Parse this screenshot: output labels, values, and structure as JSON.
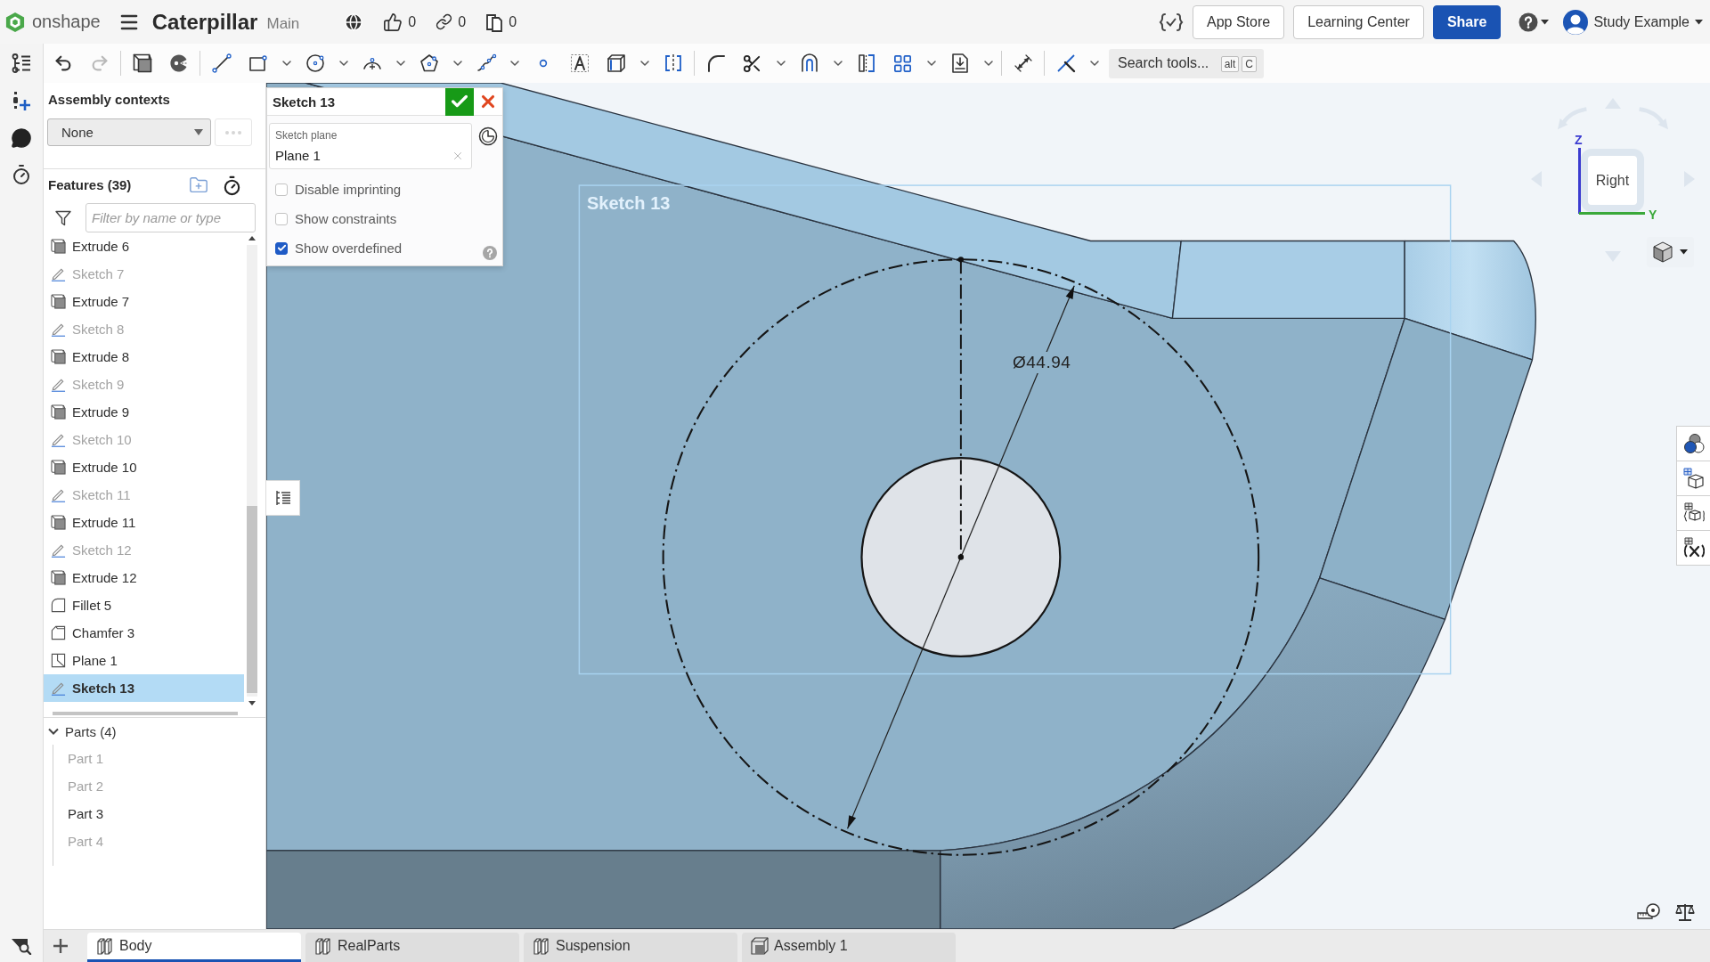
{
  "header": {
    "brand": "onshape",
    "document_title": "Caterpillar",
    "branch": "Main",
    "counters": [
      {
        "kind": "likes",
        "value": "0"
      },
      {
        "kind": "links",
        "value": "0"
      },
      {
        "kind": "copies",
        "value": "0"
      }
    ],
    "buttons": [
      {
        "label": "App Store",
        "kind": "secondary"
      },
      {
        "label": "Learning Center",
        "kind": "secondary"
      },
      {
        "label": "Share",
        "kind": "primary"
      }
    ],
    "user_name": "Study Example"
  },
  "side_rail": [
    {
      "kind": "feature_list"
    },
    {
      "kind": "insert"
    },
    {
      "kind": "comments"
    },
    {
      "kind": "history"
    }
  ],
  "toolbar": {
    "history": [
      {
        "kind": "undo",
        "disabled": false
      },
      {
        "kind": "redo",
        "disabled": true
      }
    ],
    "groups": [
      {
        "tools": [
          {
            "kind": "part_studio",
            "dropdown": false
          },
          {
            "kind": "sketch_tools",
            "dropdown": false
          }
        ]
      },
      {
        "tools": [
          {
            "kind": "line",
            "dropdown": false
          },
          {
            "kind": "rectangle",
            "dropdown": true
          },
          {
            "kind": "circle",
            "dropdown": true
          },
          {
            "kind": "arc",
            "dropdown": true
          },
          {
            "kind": "polygon",
            "dropdown": true
          },
          {
            "kind": "spline",
            "dropdown": true
          },
          {
            "kind": "point",
            "dropdown": false
          },
          {
            "kind": "text",
            "dropdown": false
          },
          {
            "kind": "use",
            "dropdown": true
          },
          {
            "kind": "mirror",
            "dropdown": false
          }
        ]
      },
      {
        "tools": [
          {
            "kind": "fillet",
            "dropdown": false
          },
          {
            "kind": "trim",
            "dropdown": true
          },
          {
            "kind": "offset",
            "dropdown": true
          },
          {
            "kind": "split",
            "dropdown": false
          },
          {
            "kind": "pattern",
            "dropdown": true
          },
          {
            "kind": "import",
            "dropdown": true
          }
        ]
      },
      {
        "tools": [
          {
            "kind": "dimension",
            "dropdown": false
          }
        ]
      },
      {
        "tools": [
          {
            "kind": "construction",
            "dropdown": true
          }
        ]
      }
    ],
    "search": {
      "placeholder": "Search tools...",
      "shortcut": [
        "alt",
        "C"
      ]
    }
  },
  "assembly_contexts": {
    "title": "Assembly contexts",
    "value": "None"
  },
  "features": {
    "title": "Features (39)",
    "filter_placeholder": "Filter by name or type",
    "items": [
      {
        "name": "Extrude 6",
        "kind": "extrude",
        "hidden": false,
        "selected": false
      },
      {
        "name": "Sketch 7",
        "kind": "sketch",
        "hidden": true,
        "selected": false
      },
      {
        "name": "Extrude 7",
        "kind": "extrude",
        "hidden": false,
        "selected": false
      },
      {
        "name": "Sketch 8",
        "kind": "sketch",
        "hidden": true,
        "selected": false
      },
      {
        "name": "Extrude 8",
        "kind": "extrude",
        "hidden": false,
        "selected": false
      },
      {
        "name": "Sketch 9",
        "kind": "sketch",
        "hidden": true,
        "selected": false
      },
      {
        "name": "Extrude 9",
        "kind": "extrude",
        "hidden": false,
        "selected": false
      },
      {
        "name": "Sketch 10",
        "kind": "sketch",
        "hidden": true,
        "selected": false
      },
      {
        "name": "Extrude 10",
        "kind": "extrude",
        "hidden": false,
        "selected": false
      },
      {
        "name": "Sketch 11",
        "kind": "sketch",
        "hidden": true,
        "selected": false
      },
      {
        "name": "Extrude 11",
        "kind": "extrude",
        "hidden": false,
        "selected": false
      },
      {
        "name": "Sketch 12",
        "kind": "sketch",
        "hidden": true,
        "selected": false
      },
      {
        "name": "Extrude 12",
        "kind": "extrude",
        "hidden": false,
        "selected": false
      },
      {
        "name": "Fillet 5",
        "kind": "fillet",
        "hidden": false,
        "selected": false
      },
      {
        "name": "Chamfer 3",
        "kind": "chamfer",
        "hidden": false,
        "selected": false
      },
      {
        "name": "Plane 1",
        "kind": "plane",
        "hidden": false,
        "selected": false
      },
      {
        "name": "Sketch 13",
        "kind": "sketch",
        "hidden": false,
        "selected": true
      }
    ]
  },
  "parts": {
    "title": "Parts (4)",
    "expanded": true,
    "items": [
      {
        "name": "Part 1",
        "hidden": true
      },
      {
        "name": "Part 2",
        "hidden": true
      },
      {
        "name": "Part 3",
        "hidden": false
      },
      {
        "name": "Part 4",
        "hidden": true
      }
    ]
  },
  "sketch_dialog": {
    "title": "Sketch 13",
    "plane_label": "Sketch plane",
    "plane_value": "Plane 1",
    "options": [
      {
        "label": "Disable imprinting",
        "checked": false
      },
      {
        "label": "Show constraints",
        "checked": false
      },
      {
        "label": "Show overdefined",
        "checked": true
      }
    ]
  },
  "viewport": {
    "sketch_label": "Sketch 13",
    "dimension": "Ø44.94",
    "view_cube": {
      "face": "Right",
      "vertical_axis": "Z",
      "horizontal_axis": "Y"
    }
  },
  "tabs": [
    {
      "label": "Body",
      "kind": "part_studio",
      "selected": true
    },
    {
      "label": "RealParts",
      "kind": "part_studio",
      "selected": false
    },
    {
      "label": "Suspension",
      "kind": "part_studio",
      "selected": false
    },
    {
      "label": "Assembly 1",
      "kind": "assembly",
      "selected": false
    }
  ]
}
